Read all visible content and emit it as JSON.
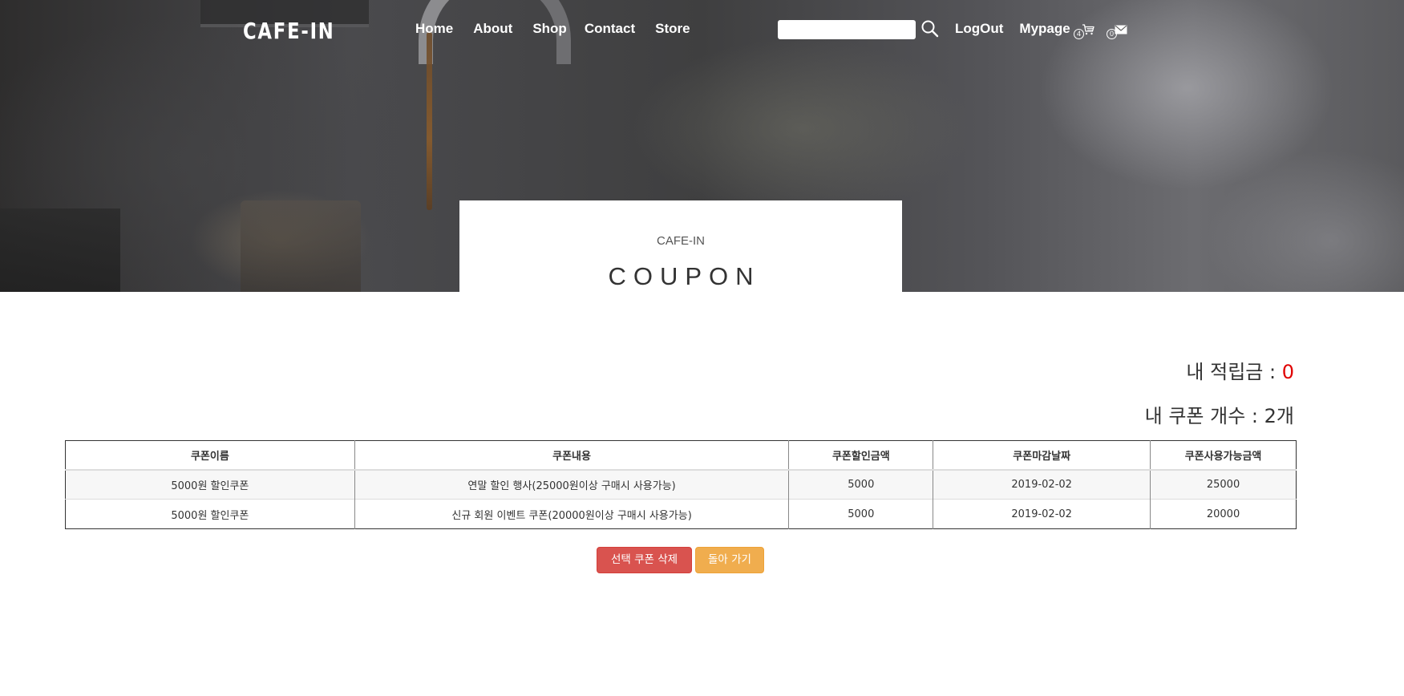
{
  "header": {
    "logo": "CAFE-IN",
    "nav": [
      "Home",
      "About",
      "Shop",
      "Contact",
      "Store"
    ],
    "search": {
      "value": "",
      "placeholder": ""
    },
    "util_links": [
      "LogOut",
      "Mypage"
    ],
    "cart_count": "4",
    "message_count": "0"
  },
  "title_card": {
    "subtitle": "CAFE-IN",
    "title": "COUPON"
  },
  "summary": {
    "points_label": "내 적립금 : ",
    "points_value": "0",
    "coupon_count_label": "내 쿠폰 개수 : 2개"
  },
  "table": {
    "headers": [
      "쿠폰이름",
      "쿠폰내용",
      "쿠폰할인금액",
      "쿠폰마감날짜",
      "쿠폰사용가능금액"
    ],
    "rows": [
      [
        "5000원 할인쿠폰",
        "연말 할인 행사(25000원이상 구매시 사용가능)",
        "5000",
        "2019-02-02",
        "25000"
      ],
      [
        "5000원 할인쿠폰",
        "신규 회원 이벤트 쿠폰(20000원이상 구매시 사용가능)",
        "5000",
        "2019-02-02",
        "20000"
      ]
    ]
  },
  "buttons": {
    "delete_label": "선택 쿠폰 삭제",
    "back_label": "돌아 가기"
  },
  "colors": {
    "danger": "#d9534f",
    "warning": "#f0ad4e",
    "points_value": "#e00000"
  },
  "icons": [
    "search-icon",
    "cart-icon",
    "mail-icon"
  ]
}
